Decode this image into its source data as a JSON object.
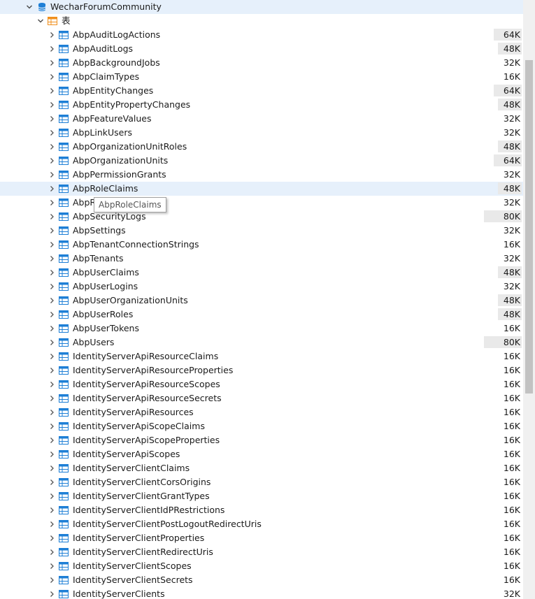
{
  "tree": {
    "database": {
      "name": "WecharForumCommunity",
      "icon": "database-icon",
      "expanded": true
    },
    "folder": {
      "name": "表",
      "icon": "table-folder-icon",
      "expanded": true
    },
    "tables": [
      {
        "name": "AbpAuditLogActions",
        "size": "64K"
      },
      {
        "name": "AbpAuditLogs",
        "size": "48K"
      },
      {
        "name": "AbpBackgroundJobs",
        "size": "32K"
      },
      {
        "name": "AbpClaimTypes",
        "size": "16K"
      },
      {
        "name": "AbpEntityChanges",
        "size": "64K"
      },
      {
        "name": "AbpEntityPropertyChanges",
        "size": "48K"
      },
      {
        "name": "AbpFeatureValues",
        "size": "32K"
      },
      {
        "name": "AbpLinkUsers",
        "size": "32K"
      },
      {
        "name": "AbpOrganizationUnitRoles",
        "size": "48K"
      },
      {
        "name": "AbpOrganizationUnits",
        "size": "64K"
      },
      {
        "name": "AbpPermissionGrants",
        "size": "32K"
      },
      {
        "name": "AbpRoleClaims",
        "size": "48K",
        "selected": true
      },
      {
        "name": "AbpRoles",
        "size": "32K"
      },
      {
        "name": "AbpSecurityLogs",
        "size": "80K"
      },
      {
        "name": "AbpSettings",
        "size": "32K"
      },
      {
        "name": "AbpTenantConnectionStrings",
        "size": "16K"
      },
      {
        "name": "AbpTenants",
        "size": "32K"
      },
      {
        "name": "AbpUserClaims",
        "size": "48K"
      },
      {
        "name": "AbpUserLogins",
        "size": "32K"
      },
      {
        "name": "AbpUserOrganizationUnits",
        "size": "48K"
      },
      {
        "name": "AbpUserRoles",
        "size": "48K"
      },
      {
        "name": "AbpUserTokens",
        "size": "16K"
      },
      {
        "name": "AbpUsers",
        "size": "80K"
      },
      {
        "name": "IdentityServerApiResourceClaims",
        "size": "16K"
      },
      {
        "name": "IdentityServerApiResourceProperties",
        "size": "16K"
      },
      {
        "name": "IdentityServerApiResourceScopes",
        "size": "16K"
      },
      {
        "name": "IdentityServerApiResourceSecrets",
        "size": "16K"
      },
      {
        "name": "IdentityServerApiResources",
        "size": "16K"
      },
      {
        "name": "IdentityServerApiScopeClaims",
        "size": "16K"
      },
      {
        "name": "IdentityServerApiScopeProperties",
        "size": "16K"
      },
      {
        "name": "IdentityServerApiScopes",
        "size": "16K"
      },
      {
        "name": "IdentityServerClientClaims",
        "size": "16K"
      },
      {
        "name": "IdentityServerClientCorsOrigins",
        "size": "16K"
      },
      {
        "name": "IdentityServerClientGrantTypes",
        "size": "16K"
      },
      {
        "name": "IdentityServerClientIdPRestrictions",
        "size": "16K"
      },
      {
        "name": "IdentityServerClientPostLogoutRedirectUris",
        "size": "16K"
      },
      {
        "name": "IdentityServerClientProperties",
        "size": "16K"
      },
      {
        "name": "IdentityServerClientRedirectUris",
        "size": "16K"
      },
      {
        "name": "IdentityServerClientScopes",
        "size": "16K"
      },
      {
        "name": "IdentityServerClientSecrets",
        "size": "16K"
      },
      {
        "name": "IdentityServerClients",
        "size": "32K"
      }
    ]
  },
  "tooltip": {
    "text": "AbpRoleClaims"
  },
  "scrollbar": {
    "position_fraction": 0.2,
    "visible_fraction": 0.58
  },
  "colors": {
    "selected_row": "#e6f0fb",
    "table_icon": "#1e7fd6",
    "database_icon": "#1e7fd6",
    "folder_icon": "#f0901e",
    "size_bar": "#e9e9e9"
  }
}
